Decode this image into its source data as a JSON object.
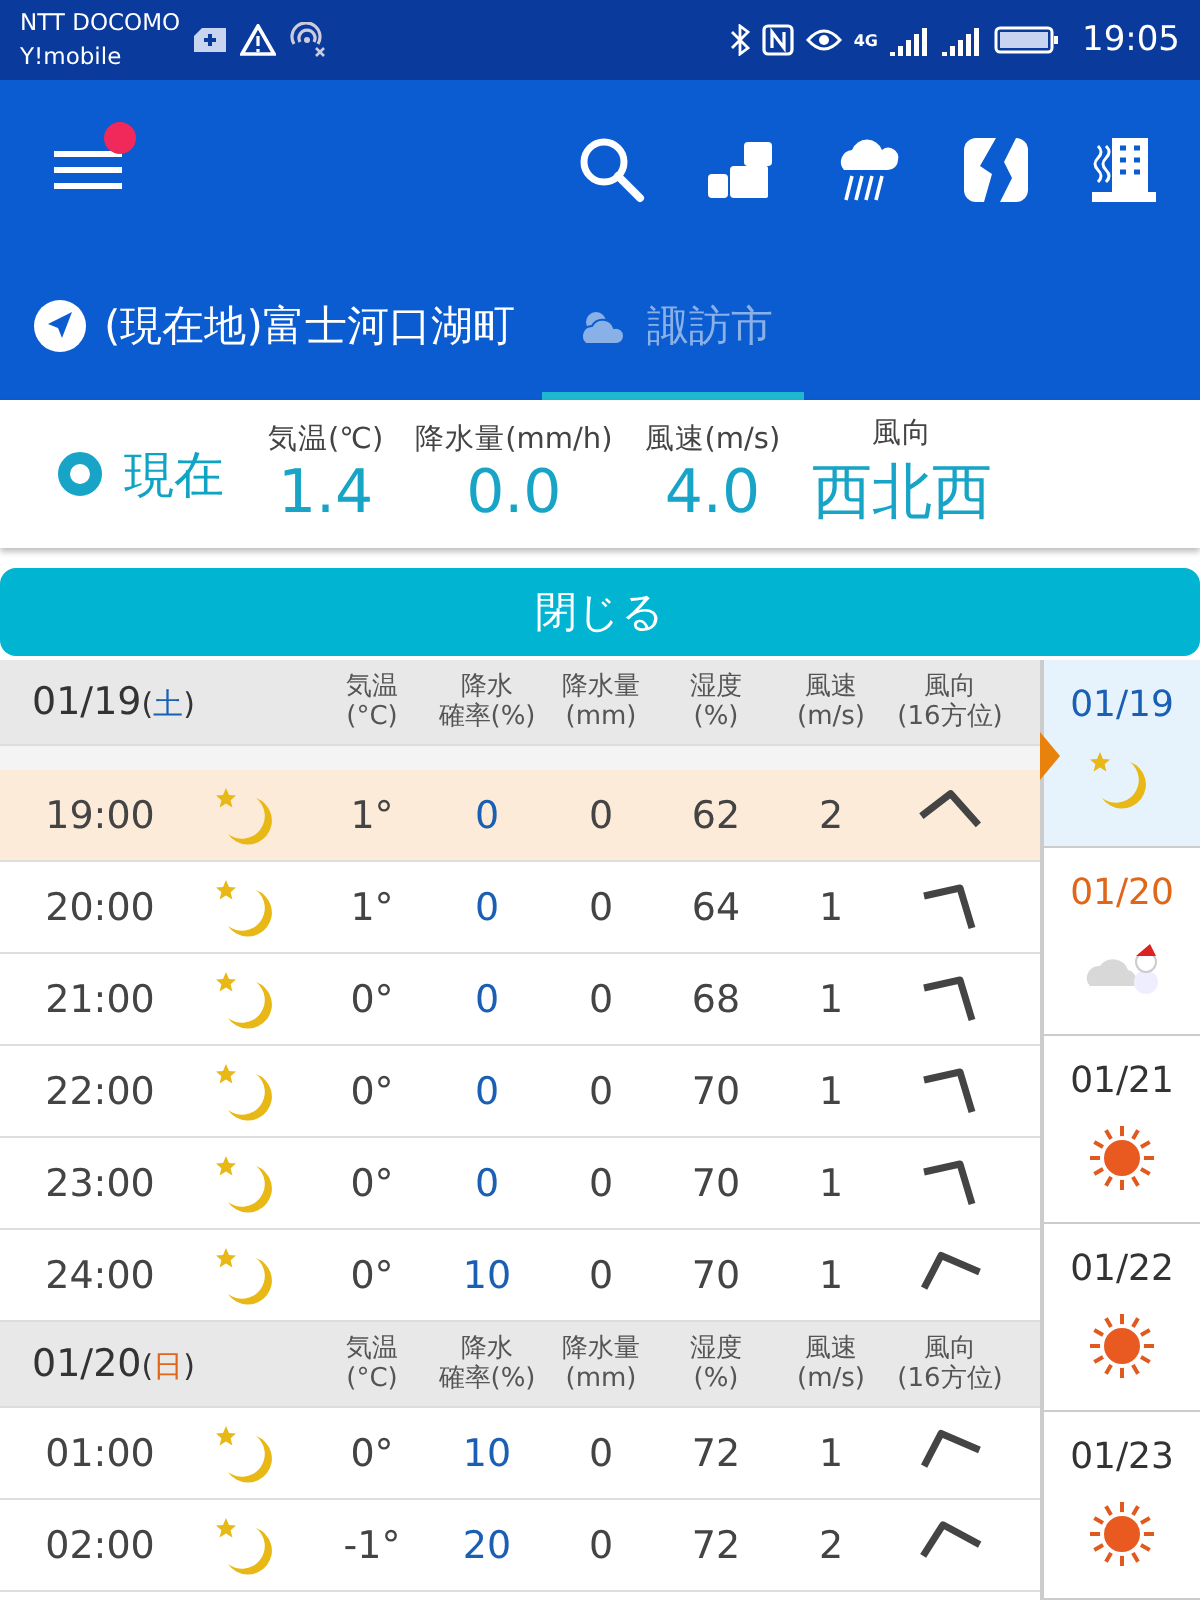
{
  "status_bar": {
    "carriers": [
      "NTT DOCOMO",
      "Y!mobile"
    ],
    "network": "4G",
    "time": "19:05"
  },
  "app_bar": {
    "menu_badge": true
  },
  "tabs": [
    {
      "label": "(現在地)富士河口湖町",
      "kind": "location",
      "selected": false
    },
    {
      "label": "諏訪市",
      "kind": "weather",
      "selected": true
    }
  ],
  "current": {
    "label": "現在",
    "items": [
      {
        "label": "気温(℃)",
        "value": "1.4"
      },
      {
        "label": "降水量(mm/h)",
        "value": "0.0"
      },
      {
        "label": "風速(m/s)",
        "value": "4.0"
      },
      {
        "label": "風向",
        "value": "西北西"
      }
    ]
  },
  "close_button": "閉じる",
  "days": [
    {
      "date": "01/19",
      "open": "(",
      "weekday": "土",
      "close": ")",
      "color": "#1a5fb4",
      "columns": [
        [
          "気温",
          "(°C)"
        ],
        [
          "降水",
          "確率(%)"
        ],
        [
          "降水量",
          "(mm)"
        ],
        [
          "湿度",
          "(%)"
        ],
        [
          "風速",
          "(m/s)"
        ],
        [
          "風向",
          "(16方位)"
        ]
      ],
      "rows": [
        {
          "time": "19:00",
          "temp": "1°",
          "prob": "0",
          "amount": "0",
          "humidity": "62",
          "wind": "2",
          "kind": "nw",
          "selected": true
        },
        {
          "time": "20:00",
          "temp": "1°",
          "prob": "0",
          "amount": "0",
          "humidity": "64",
          "wind": "1",
          "kind": "wnw",
          "selected": false
        },
        {
          "time": "21:00",
          "temp": "0°",
          "prob": "0",
          "amount": "0",
          "humidity": "68",
          "wind": "1",
          "kind": "wnw",
          "selected": false
        },
        {
          "time": "22:00",
          "temp": "0°",
          "prob": "0",
          "amount": "0",
          "humidity": "70",
          "wind": "1",
          "kind": "wnw",
          "selected": false
        },
        {
          "time": "23:00",
          "temp": "0°",
          "prob": "0",
          "amount": "0",
          "humidity": "70",
          "wind": "1",
          "kind": "wnw",
          "selected": false
        },
        {
          "time": "24:00",
          "temp": "0°",
          "prob": "10",
          "amount": "0",
          "humidity": "70",
          "wind": "1",
          "kind": "n",
          "selected": false
        }
      ]
    },
    {
      "date": "01/20",
      "open": "(",
      "weekday": "日",
      "close": ")",
      "color": "#e0661a",
      "columns": [
        [
          "気温",
          "(°C)"
        ],
        [
          "降水",
          "確率(%)"
        ],
        [
          "降水量",
          "(mm)"
        ],
        [
          "湿度",
          "(%)"
        ],
        [
          "風速",
          "(m/s)"
        ],
        [
          "風向",
          "(16方位)"
        ]
      ],
      "rows": [
        {
          "time": "01:00",
          "temp": "0°",
          "prob": "10",
          "amount": "0",
          "humidity": "72",
          "wind": "1",
          "kind": "n",
          "selected": false
        },
        {
          "time": "02:00",
          "temp": "-1°",
          "prob": "20",
          "amount": "0",
          "humidity": "72",
          "wind": "2",
          "kind": "nn",
          "selected": false
        }
      ]
    }
  ],
  "day_list": [
    {
      "date": "01/19",
      "kind": "night",
      "selected": true,
      "color": "#1a5fb4"
    },
    {
      "date": "01/20",
      "kind": "snow",
      "selected": false,
      "color": "#e0661a"
    },
    {
      "date": "01/21",
      "kind": "sunny",
      "selected": false,
      "color": "#333333"
    },
    {
      "date": "01/22",
      "kind": "sunny",
      "selected": false,
      "color": "#333333"
    },
    {
      "date": "01/23",
      "kind": "sunny",
      "selected": false,
      "color": "#333333"
    }
  ]
}
